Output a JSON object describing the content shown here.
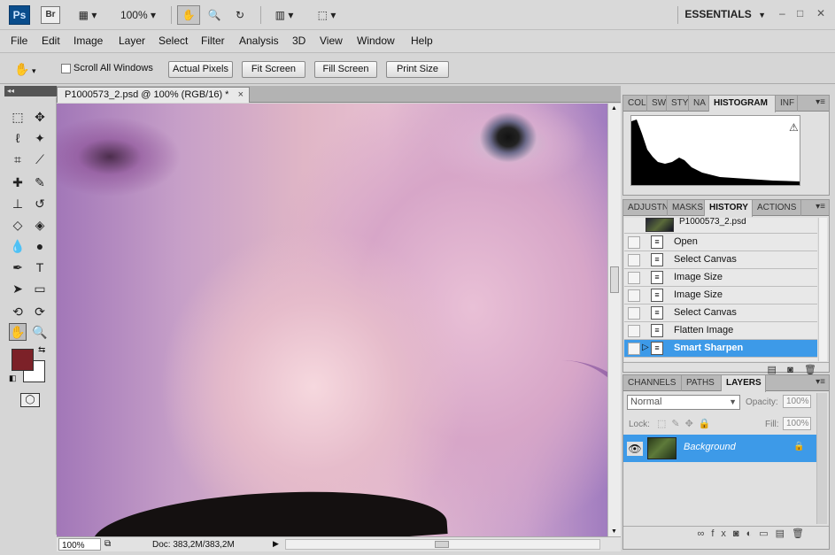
{
  "appbar": {
    "logo": "Ps",
    "bridge": "Br",
    "zoom": "100%",
    "workspace": "ESSENTIALS",
    "workspace_arrow": "▼",
    "minimize": "–",
    "maximize": "□",
    "close": "✕"
  },
  "menu": [
    "File",
    "Edit",
    "Image",
    "Layer",
    "Select",
    "Filter",
    "Analysis",
    "3D",
    "View",
    "Window",
    "Help"
  ],
  "options": {
    "scroll_all_windows": "Scroll All Windows",
    "actual_pixels": "Actual Pixels",
    "fit_screen": "Fit Screen",
    "fill_screen": "Fill Screen",
    "print_size": "Print Size"
  },
  "tools_header": "◂◂",
  "document": {
    "tab_title": "P1000573_2.psd @ 100% (RGB/16) *",
    "close": "×",
    "zoom": "100%",
    "doc_info": "Doc: 383,2M/383,2M"
  },
  "colors": {
    "foreground": "#7c2128",
    "background": "#ffffff",
    "selection": "#3d9ae8"
  },
  "histogram_panel": {
    "tabs": [
      "COL",
      "SW",
      "STY",
      "NA",
      "HISTOGRAM",
      "INF"
    ],
    "active_tab": "HISTOGRAM",
    "warning_icon": "⚠"
  },
  "history_panel": {
    "tabs": [
      "ADJUSTN",
      "MASKS",
      "HISTORY",
      "ACTIONS"
    ],
    "active_tab": "HISTORY",
    "snapshot": "P1000573_2.psd",
    "items": [
      "Open",
      "Select Canvas",
      "Image Size",
      "Image Size",
      "Select Canvas",
      "Flatten Image",
      "Smart Sharpen"
    ],
    "selected": "Smart Sharpen"
  },
  "layers_panel": {
    "tabs": [
      "CHANNELS",
      "PATHS",
      "LAYERS"
    ],
    "active_tab": "LAYERS",
    "blend_mode": "Normal",
    "opacity_label": "Opacity:",
    "opacity": "100%",
    "lock_label": "Lock:",
    "fill_label": "Fill:",
    "fill": "100%",
    "layer_name": "Background"
  }
}
